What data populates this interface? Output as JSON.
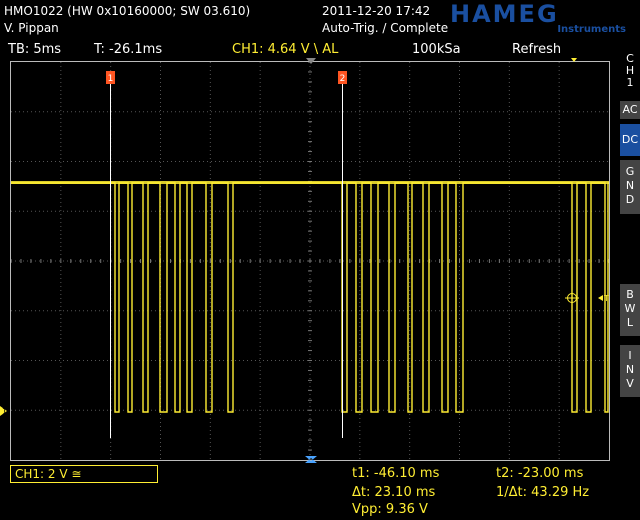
{
  "header": {
    "device_line": "HMO1022 (HW 0x10160000; SW 03.610)",
    "user_line": "V. Pippan",
    "datetime": "2011-12-20 17:42",
    "trigger_status": "Auto-Trig. / Complete",
    "logo_text": "HAMEG",
    "logo_sub": "Instruments",
    "logo_color": "#1a4fa0"
  },
  "status": {
    "timebase": "TB: 5ms",
    "trigger_time": "T: -26.1ms",
    "ch1_trigger": "CH1: 4.64 V \\ AL",
    "sample_rate": "100kSa",
    "mode": "Refresh"
  },
  "side": {
    "channel_label": "CH1",
    "ac_label": "AC",
    "dc_label": "DC",
    "gnd_label": "GND",
    "bwl_label": "BWL",
    "inv_label": "INV"
  },
  "cursors": {
    "cursor1_label": "1",
    "cursor2_label": "2"
  },
  "channel_box": {
    "label": "CH1: 2 V ≅"
  },
  "measurements": {
    "t1": "t1: -46.10 ms",
    "t2": "t2: -23.00 ms",
    "dt": "Δt: 23.10 ms",
    "inv_dt": "1/Δt: 43.29 Hz",
    "vpp": "Vpp: 9.36 V"
  },
  "colors": {
    "trace": "#ffee33",
    "grid": "#555555",
    "cursor": "#ff5522",
    "active_button": "#1a4fa0"
  }
}
